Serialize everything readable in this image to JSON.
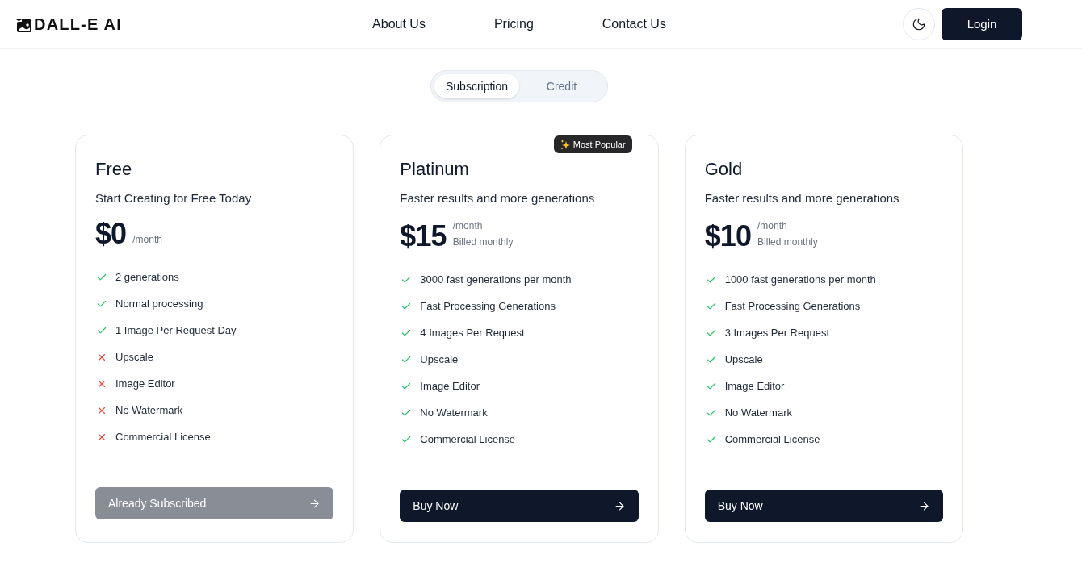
{
  "header": {
    "logo": "DALL-E AI",
    "nav": [
      "About Us",
      "Pricing",
      "Contact Us"
    ],
    "login": "Login"
  },
  "billing_tabs": [
    {
      "label": "Subscription",
      "selected": true
    },
    {
      "label": "Credit",
      "selected": false
    }
  ],
  "plans": [
    {
      "name": "Free",
      "tagline": "Start Creating for Free Today",
      "price": "$0",
      "period": "/month",
      "features": [
        {
          "label": "2 generations",
          "included": true
        },
        {
          "label": "Normal processing",
          "included": true
        },
        {
          "label": "1 Image Per Request Day",
          "included": true
        },
        {
          "label": "Upscale",
          "included": false
        },
        {
          "label": "Image Editor",
          "included": false
        },
        {
          "label": "No Watermark",
          "included": false
        },
        {
          "label": "Commercial License",
          "included": false
        }
      ],
      "button": {
        "label": "Already Subscribed",
        "disabled": true
      }
    },
    {
      "name": "Platinum",
      "badge": "Most Popular",
      "tagline": "Faster results and more generations",
      "price": "$15",
      "period": "/month",
      "billing_note": "Billed monthly",
      "features": [
        {
          "label": "3000 fast generations per month",
          "included": true
        },
        {
          "label": "Fast Processing Generations",
          "included": true
        },
        {
          "label": "4 Images Per Request",
          "included": true
        },
        {
          "label": "Upscale",
          "included": true
        },
        {
          "label": "Image Editor",
          "included": true
        },
        {
          "label": "No Watermark",
          "included": true
        },
        {
          "label": "Commercial License",
          "included": true
        }
      ],
      "button": {
        "label": "Buy Now",
        "disabled": false
      }
    },
    {
      "name": "Gold",
      "tagline": "Faster results and more generations",
      "price": "$10",
      "period": "/month",
      "billing_note": "Billed monthly",
      "features": [
        {
          "label": "1000 fast generations per month",
          "included": true
        },
        {
          "label": "Fast Processing Generations",
          "included": true
        },
        {
          "label": "3 Images Per Request",
          "included": true
        },
        {
          "label": "Upscale",
          "included": true
        },
        {
          "label": "Image Editor",
          "included": true
        },
        {
          "label": "No Watermark",
          "included": true
        },
        {
          "label": "Commercial License",
          "included": true
        }
      ],
      "button": {
        "label": "Buy Now",
        "disabled": false
      }
    }
  ]
}
